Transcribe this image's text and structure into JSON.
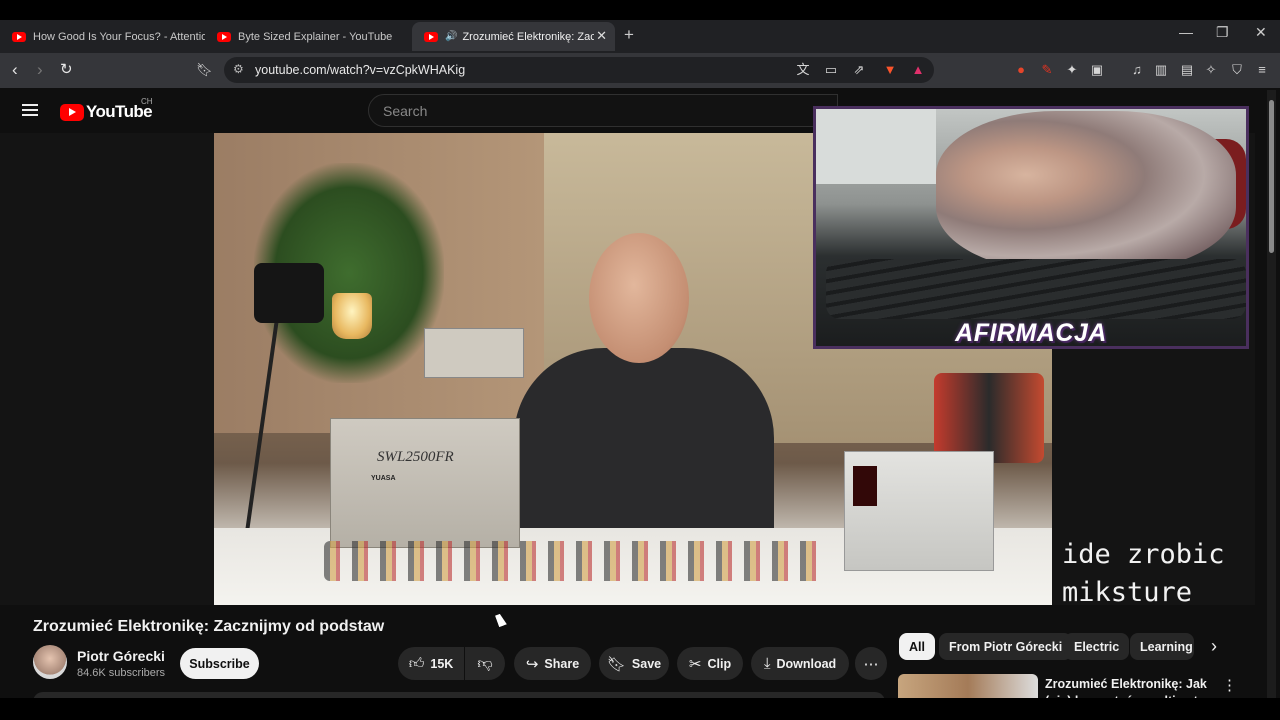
{
  "browser": {
    "tabs": [
      {
        "label": "How Good Is Your Focus? - Attention"
      },
      {
        "label": "Byte Sized Explainer - YouTube"
      },
      {
        "label": "Zrozumieć Elektronikę: Zaczni",
        "active": true,
        "audio": true
      }
    ],
    "url": "youtube.com/watch?v=vzCpkWHAKig"
  },
  "youtube": {
    "logo_text": "YouTube",
    "country_code": "CH",
    "search_placeholder": "Search"
  },
  "video": {
    "overlay_text": "ide zrobic\nmiksture",
    "webcam_caption": "AFIRMACJA",
    "battery_model": "SWL2500FR",
    "battery_brand": "YUASA",
    "title": "Zrozumieć Elektronikę: Zacznijmy od podstaw"
  },
  "channel": {
    "name": "Piotr Górecki",
    "subscribers": "84.6K subscribers",
    "subscribe_label": "Subscribe"
  },
  "actions": {
    "likes": "15K",
    "share": "Share",
    "save": "Save",
    "clip": "Clip",
    "download": "Download"
  },
  "chips": [
    "All",
    "From Piotr Górecki",
    "Electric",
    "Learning"
  ],
  "recommendation": {
    "title": "Zrozumieć Elektronikę: Jak (nie) korzystać z multimetru -"
  }
}
